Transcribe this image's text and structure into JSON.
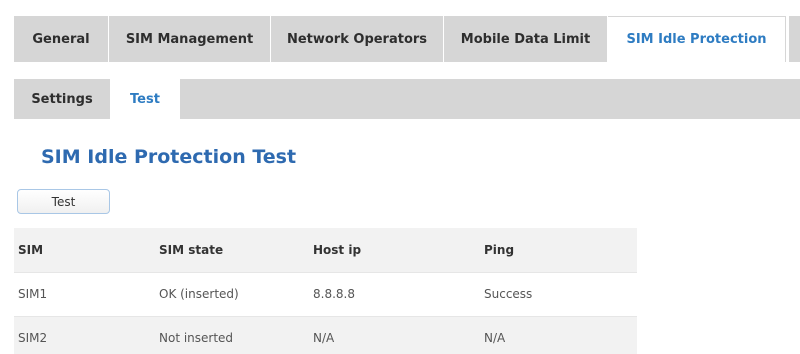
{
  "top_tabs": [
    {
      "label": "General",
      "active": false
    },
    {
      "label": "SIM Management",
      "active": false
    },
    {
      "label": "Network Operators",
      "active": false
    },
    {
      "label": "Mobile Data Limit",
      "active": false
    },
    {
      "label": "SIM Idle Protection",
      "active": true
    }
  ],
  "sub_tabs": [
    {
      "label": "Settings",
      "active": false
    },
    {
      "label": "Test",
      "active": true
    }
  ],
  "page_title": "SIM Idle Protection Test",
  "test_button_label": "Test",
  "table": {
    "headers": [
      "SIM",
      "SIM state",
      "Host ip",
      "Ping"
    ],
    "rows": [
      [
        "SIM1",
        "OK (inserted)",
        "8.8.8.8",
        "Success"
      ],
      [
        "SIM2",
        "Not inserted",
        "N/A",
        "N/A"
      ]
    ]
  },
  "colors": {
    "accent": "#2e7cc2",
    "tab_bar": "#d6d6d6",
    "title": "#2e6ab0"
  }
}
